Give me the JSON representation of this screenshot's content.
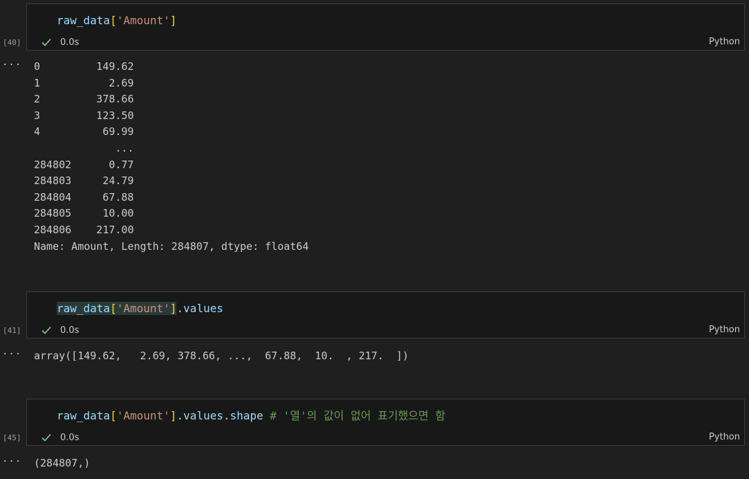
{
  "cells": [
    {
      "exec_count": "[40]",
      "code": {
        "var": "raw_data",
        "open": "[",
        "str": "'Amount'",
        "close": "]"
      },
      "time": "0.0s",
      "lang": "Python",
      "output_rows": [
        {
          "idx": "0",
          "val": "149.62"
        },
        {
          "idx": "1",
          "val": "2.69"
        },
        {
          "idx": "2",
          "val": "378.66"
        },
        {
          "idx": "3",
          "val": "123.50"
        },
        {
          "idx": "4",
          "val": "69.99"
        },
        {
          "idx": "",
          "val": "..."
        },
        {
          "idx": "284802",
          "val": "0.77"
        },
        {
          "idx": "284803",
          "val": "24.79"
        },
        {
          "idx": "284804",
          "val": "67.88"
        },
        {
          "idx": "284805",
          "val": "10.00"
        },
        {
          "idx": "284806",
          "val": "217.00"
        }
      ],
      "output_footer": "Name: Amount, Length: 284807, dtype: float64"
    },
    {
      "exec_count": "[41]",
      "code": {
        "var": "raw_data",
        "open": "[",
        "str": "'Amount'",
        "close": "]",
        "dot": ".",
        "prop": "values"
      },
      "time": "0.0s",
      "lang": "Python",
      "output": "array([149.62,   2.69, 378.66, ...,  67.88,  10.  , 217.  ])"
    },
    {
      "exec_count": "[45]",
      "code": {
        "var": "raw_data",
        "open": "[",
        "str": "'Amount'",
        "close": "]",
        "dot": ".",
        "prop": "values",
        "dot2": ".",
        "prop2": "shape",
        "comment": " # '열'의 값이 없어 표기했으면 함"
      },
      "time": "0.0s",
      "lang": "Python",
      "output": "(284807,)"
    }
  ],
  "more_glyph": "···",
  "colors": {
    "check": "#89d185",
    "background": "#1f1f1f",
    "editor": "#181818"
  }
}
